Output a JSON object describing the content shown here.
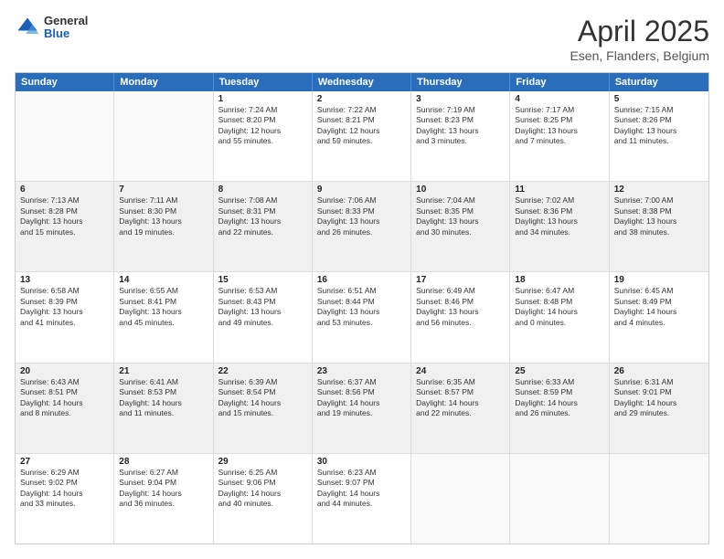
{
  "header": {
    "logo_general": "General",
    "logo_blue": "Blue",
    "title": "April 2025",
    "subtitle": "Esen, Flanders, Belgium"
  },
  "calendar": {
    "days_of_week": [
      "Sunday",
      "Monday",
      "Tuesday",
      "Wednesday",
      "Thursday",
      "Friday",
      "Saturday"
    ],
    "rows": [
      [
        {
          "day": "",
          "info": "",
          "empty": true
        },
        {
          "day": "",
          "info": "",
          "empty": true
        },
        {
          "day": "1",
          "info": "Sunrise: 7:24 AM\nSunset: 8:20 PM\nDaylight: 12 hours\nand 55 minutes."
        },
        {
          "day": "2",
          "info": "Sunrise: 7:22 AM\nSunset: 8:21 PM\nDaylight: 12 hours\nand 59 minutes."
        },
        {
          "day": "3",
          "info": "Sunrise: 7:19 AM\nSunset: 8:23 PM\nDaylight: 13 hours\nand 3 minutes."
        },
        {
          "day": "4",
          "info": "Sunrise: 7:17 AM\nSunset: 8:25 PM\nDaylight: 13 hours\nand 7 minutes."
        },
        {
          "day": "5",
          "info": "Sunrise: 7:15 AM\nSunset: 8:26 PM\nDaylight: 13 hours\nand 11 minutes."
        }
      ],
      [
        {
          "day": "6",
          "info": "Sunrise: 7:13 AM\nSunset: 8:28 PM\nDaylight: 13 hours\nand 15 minutes.",
          "shaded": true
        },
        {
          "day": "7",
          "info": "Sunrise: 7:11 AM\nSunset: 8:30 PM\nDaylight: 13 hours\nand 19 minutes.",
          "shaded": true
        },
        {
          "day": "8",
          "info": "Sunrise: 7:08 AM\nSunset: 8:31 PM\nDaylight: 13 hours\nand 22 minutes.",
          "shaded": true
        },
        {
          "day": "9",
          "info": "Sunrise: 7:06 AM\nSunset: 8:33 PM\nDaylight: 13 hours\nand 26 minutes.",
          "shaded": true
        },
        {
          "day": "10",
          "info": "Sunrise: 7:04 AM\nSunset: 8:35 PM\nDaylight: 13 hours\nand 30 minutes.",
          "shaded": true
        },
        {
          "day": "11",
          "info": "Sunrise: 7:02 AM\nSunset: 8:36 PM\nDaylight: 13 hours\nand 34 minutes.",
          "shaded": true
        },
        {
          "day": "12",
          "info": "Sunrise: 7:00 AM\nSunset: 8:38 PM\nDaylight: 13 hours\nand 38 minutes.",
          "shaded": true
        }
      ],
      [
        {
          "day": "13",
          "info": "Sunrise: 6:58 AM\nSunset: 8:39 PM\nDaylight: 13 hours\nand 41 minutes."
        },
        {
          "day": "14",
          "info": "Sunrise: 6:55 AM\nSunset: 8:41 PM\nDaylight: 13 hours\nand 45 minutes."
        },
        {
          "day": "15",
          "info": "Sunrise: 6:53 AM\nSunset: 8:43 PM\nDaylight: 13 hours\nand 49 minutes."
        },
        {
          "day": "16",
          "info": "Sunrise: 6:51 AM\nSunset: 8:44 PM\nDaylight: 13 hours\nand 53 minutes."
        },
        {
          "day": "17",
          "info": "Sunrise: 6:49 AM\nSunset: 8:46 PM\nDaylight: 13 hours\nand 56 minutes."
        },
        {
          "day": "18",
          "info": "Sunrise: 6:47 AM\nSunset: 8:48 PM\nDaylight: 14 hours\nand 0 minutes."
        },
        {
          "day": "19",
          "info": "Sunrise: 6:45 AM\nSunset: 8:49 PM\nDaylight: 14 hours\nand 4 minutes."
        }
      ],
      [
        {
          "day": "20",
          "info": "Sunrise: 6:43 AM\nSunset: 8:51 PM\nDaylight: 14 hours\nand 8 minutes.",
          "shaded": true
        },
        {
          "day": "21",
          "info": "Sunrise: 6:41 AM\nSunset: 8:53 PM\nDaylight: 14 hours\nand 11 minutes.",
          "shaded": true
        },
        {
          "day": "22",
          "info": "Sunrise: 6:39 AM\nSunset: 8:54 PM\nDaylight: 14 hours\nand 15 minutes.",
          "shaded": true
        },
        {
          "day": "23",
          "info": "Sunrise: 6:37 AM\nSunset: 8:56 PM\nDaylight: 14 hours\nand 19 minutes.",
          "shaded": true
        },
        {
          "day": "24",
          "info": "Sunrise: 6:35 AM\nSunset: 8:57 PM\nDaylight: 14 hours\nand 22 minutes.",
          "shaded": true
        },
        {
          "day": "25",
          "info": "Sunrise: 6:33 AM\nSunset: 8:59 PM\nDaylight: 14 hours\nand 26 minutes.",
          "shaded": true
        },
        {
          "day": "26",
          "info": "Sunrise: 6:31 AM\nSunset: 9:01 PM\nDaylight: 14 hours\nand 29 minutes.",
          "shaded": true
        }
      ],
      [
        {
          "day": "27",
          "info": "Sunrise: 6:29 AM\nSunset: 9:02 PM\nDaylight: 14 hours\nand 33 minutes."
        },
        {
          "day": "28",
          "info": "Sunrise: 6:27 AM\nSunset: 9:04 PM\nDaylight: 14 hours\nand 36 minutes."
        },
        {
          "day": "29",
          "info": "Sunrise: 6:25 AM\nSunset: 9:06 PM\nDaylight: 14 hours\nand 40 minutes."
        },
        {
          "day": "30",
          "info": "Sunrise: 6:23 AM\nSunset: 9:07 PM\nDaylight: 14 hours\nand 44 minutes."
        },
        {
          "day": "",
          "info": "",
          "empty": true
        },
        {
          "day": "",
          "info": "",
          "empty": true
        },
        {
          "day": "",
          "info": "",
          "empty": true
        }
      ]
    ]
  }
}
